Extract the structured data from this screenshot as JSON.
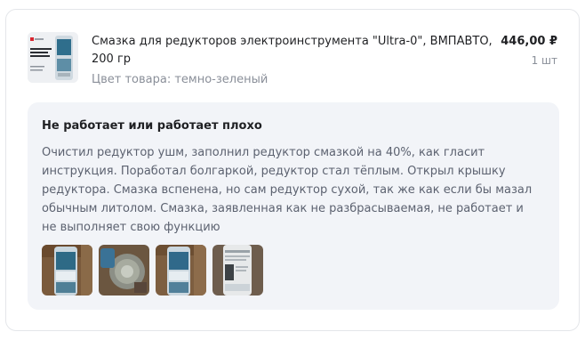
{
  "product": {
    "title": "Смазка для редукторов электроинструмента \"Ultra-0\", ВМПАВТО, 200 гр",
    "color_line": "Цвет товара: темно-зеленый",
    "price": "446,00 ₽",
    "quantity": "1 шт",
    "thumbnail_caption": "ПРОДЛЕВАЕТ РЕСУРС ИНСТРУМЕНТА"
  },
  "review": {
    "title": "Не работает или работает плохо",
    "text": "Очистил редуктор ушм, заполнил редуктор смазкой на 40%, как гласит инструкция. Поработал болгаркой, редуктор стал тёплым. Открыл крышку редуктора. Смазка вспенена, но сам редуктор сухой, так же как если бы мазал обычным литолом. Смазка, заявленная как не разбрасываемая, не работает и не выполняет свою функцию",
    "photos": [
      {
        "name": "review-photo-1",
        "tube_label": "УШМ"
      },
      {
        "name": "review-photo-2",
        "tube_label": ""
      },
      {
        "name": "review-photo-3",
        "tube_label": "УШМ"
      },
      {
        "name": "review-photo-4",
        "tube_label": ""
      }
    ]
  },
  "colors": {
    "text_primary": "#1f2023",
    "text_secondary": "#8a8f99",
    "review_text": "#5c6270",
    "review_bg": "#f2f4f8",
    "border": "#e4e6ea"
  }
}
